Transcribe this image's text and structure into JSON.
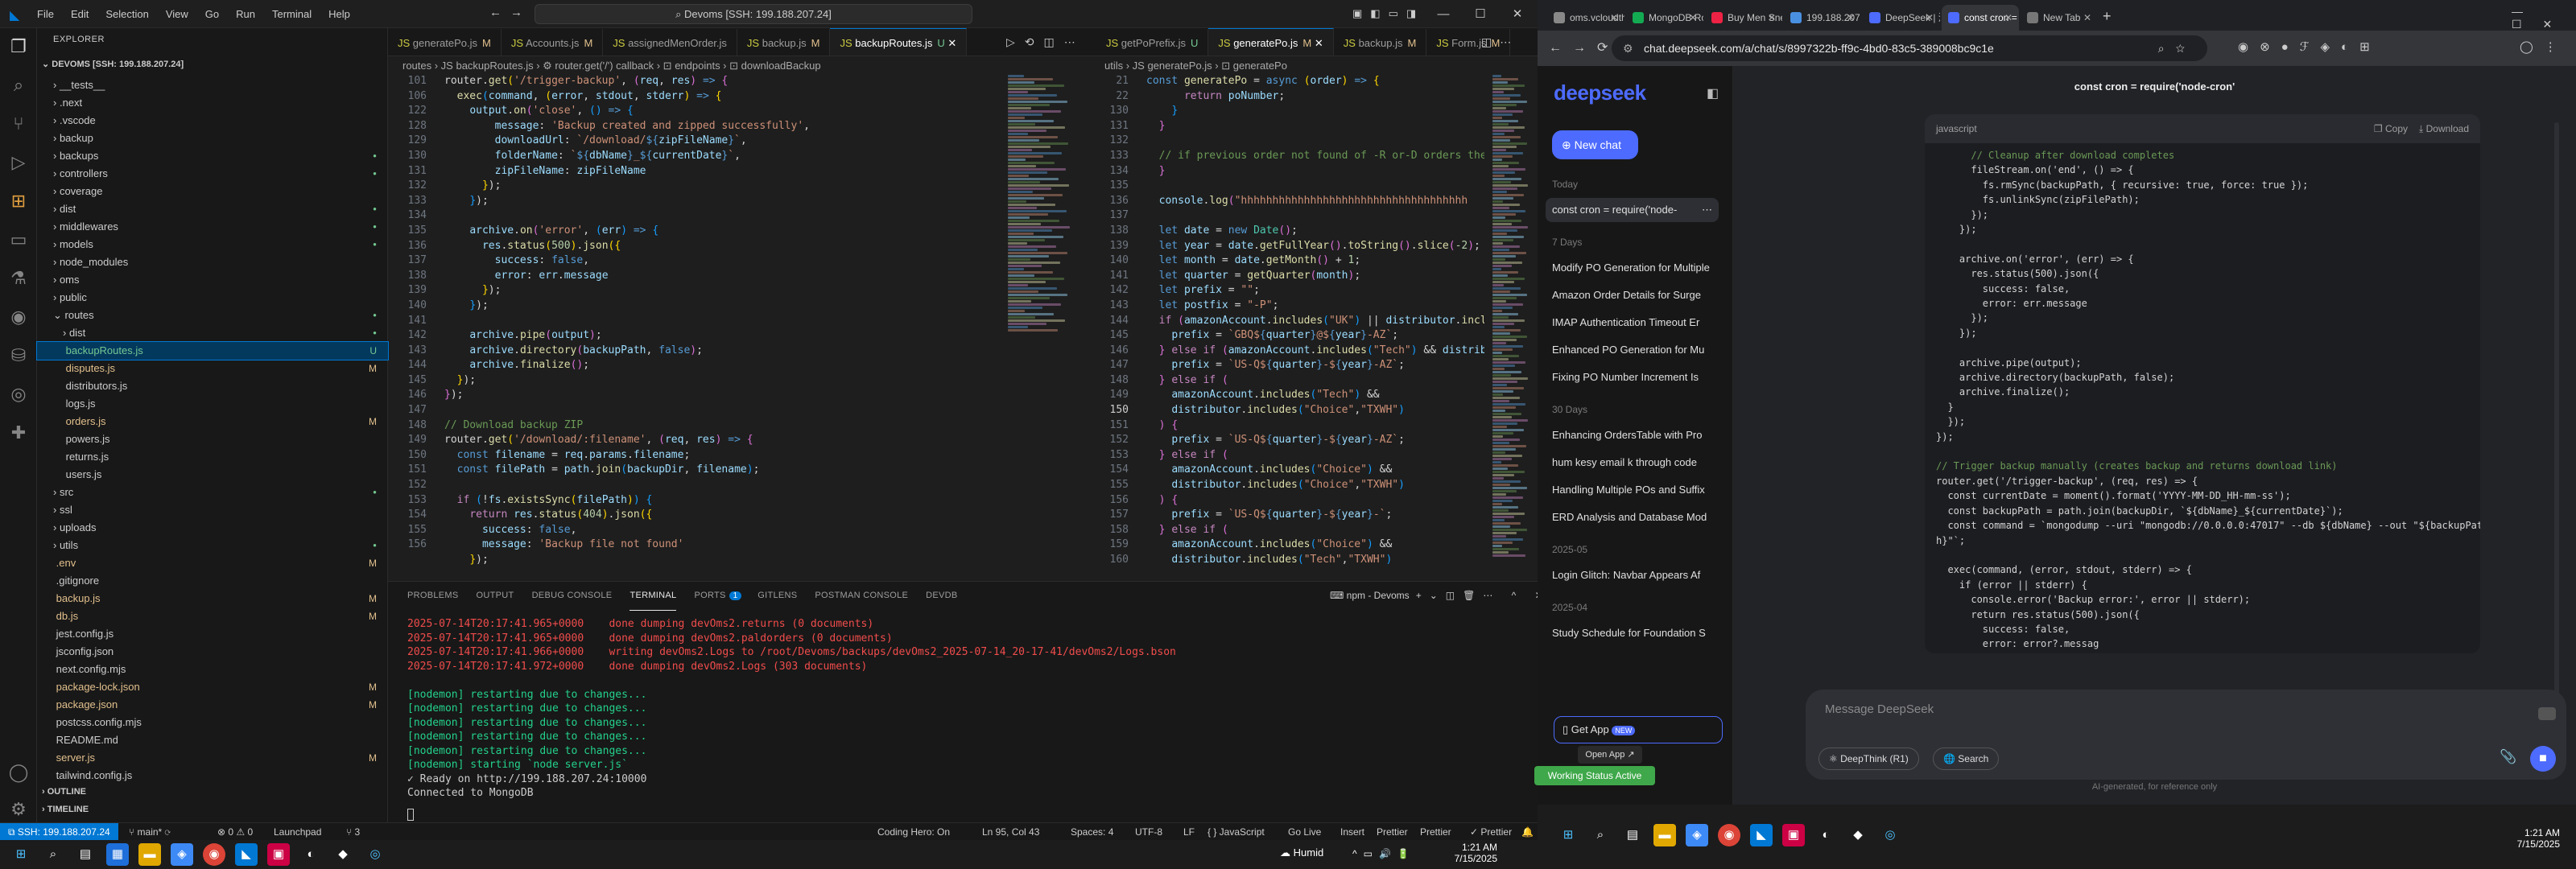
{
  "vscode": {
    "menu": [
      "File",
      "Edit",
      "Selection",
      "View",
      "Go",
      "Run",
      "Terminal",
      "Help"
    ],
    "command_center": "Devoms [SSH: 199.188.207.24]",
    "explorer": {
      "title": "EXPLORER",
      "root": "DEVOMS [SSH: 199.188.207.24]",
      "items": [
        {
          "label": "__tests__",
          "depth": 1,
          "type": "folder",
          "git": ""
        },
        {
          "label": ".next",
          "depth": 1,
          "type": "folder",
          "git": ""
        },
        {
          "label": ".vscode",
          "depth": 1,
          "type": "folder",
          "git": ""
        },
        {
          "label": "backup",
          "depth": 1,
          "type": "folder",
          "git": ""
        },
        {
          "label": "backups",
          "depth": 1,
          "type": "folder",
          "git": "dot"
        },
        {
          "label": "controllers",
          "depth": 1,
          "type": "folder",
          "git": "dot"
        },
        {
          "label": "coverage",
          "depth": 1,
          "type": "folder",
          "git": ""
        },
        {
          "label": "dist",
          "depth": 1,
          "type": "folder",
          "git": "dot"
        },
        {
          "label": "middlewares",
          "depth": 1,
          "type": "folder",
          "git": "dot"
        },
        {
          "label": "models",
          "depth": 1,
          "type": "folder",
          "git": "dot"
        },
        {
          "label": "node_modules",
          "depth": 1,
          "type": "folder",
          "git": ""
        },
        {
          "label": "oms",
          "depth": 1,
          "type": "folder",
          "git": ""
        },
        {
          "label": "public",
          "depth": 1,
          "type": "folder",
          "git": ""
        },
        {
          "label": "routes",
          "depth": 1,
          "type": "folder-open",
          "git": "dot"
        },
        {
          "label": "dist",
          "depth": 2,
          "type": "folder",
          "git": "dot"
        },
        {
          "label": "backupRoutes.js",
          "depth": 2,
          "type": "file",
          "git": "U",
          "selected": true
        },
        {
          "label": "disputes.js",
          "depth": 2,
          "type": "file",
          "git": "M"
        },
        {
          "label": "distributors.js",
          "depth": 2,
          "type": "file",
          "git": ""
        },
        {
          "label": "logs.js",
          "depth": 2,
          "type": "file",
          "git": ""
        },
        {
          "label": "orders.js",
          "depth": 2,
          "type": "file",
          "git": "M"
        },
        {
          "label": "powers.js",
          "depth": 2,
          "type": "file",
          "git": ""
        },
        {
          "label": "returns.js",
          "depth": 2,
          "type": "file",
          "git": ""
        },
        {
          "label": "users.js",
          "depth": 2,
          "type": "file",
          "git": ""
        },
        {
          "label": "src",
          "depth": 1,
          "type": "folder",
          "git": "dot"
        },
        {
          "label": "ssl",
          "depth": 1,
          "type": "folder",
          "git": ""
        },
        {
          "label": "uploads",
          "depth": 1,
          "type": "folder",
          "git": ""
        },
        {
          "label": "utils",
          "depth": 1,
          "type": "folder",
          "git": "dot"
        },
        {
          "label": ".env",
          "depth": 1,
          "type": "file",
          "git": "M"
        },
        {
          "label": ".gitignore",
          "depth": 1,
          "type": "file",
          "git": ""
        },
        {
          "label": "backup.js",
          "depth": 1,
          "type": "file",
          "git": "M"
        },
        {
          "label": "db.js",
          "depth": 1,
          "type": "file",
          "git": "M"
        },
        {
          "label": "jest.config.js",
          "depth": 1,
          "type": "file",
          "git": ""
        },
        {
          "label": "jsconfig.json",
          "depth": 1,
          "type": "file",
          "git": ""
        },
        {
          "label": "next.config.mjs",
          "depth": 1,
          "type": "file",
          "git": ""
        },
        {
          "label": "package-lock.json",
          "depth": 1,
          "type": "file",
          "git": "M"
        },
        {
          "label": "package.json",
          "depth": 1,
          "type": "file",
          "git": "M"
        },
        {
          "label": "postcss.config.mjs",
          "depth": 1,
          "type": "file",
          "git": ""
        },
        {
          "label": "README.md",
          "depth": 1,
          "type": "file",
          "git": ""
        },
        {
          "label": "server.js",
          "depth": 1,
          "type": "file",
          "git": "M"
        },
        {
          "label": "tailwind.config.js",
          "depth": 1,
          "type": "file",
          "git": ""
        }
      ],
      "outline": "OUTLINE",
      "timeline": "TIMELINE"
    },
    "tabs_left": [
      {
        "label": "generatePo.js",
        "mark": "M"
      },
      {
        "label": "Accounts.js",
        "mark": "M"
      },
      {
        "label": "assignedMenOrder.js",
        "mark": ""
      },
      {
        "label": "backup.js",
        "mark": "M"
      },
      {
        "label": "backupRoutes.js",
        "mark": "U",
        "active": true
      }
    ],
    "tabs_right": [
      {
        "label": "getPoPrefix.js",
        "mark": "U"
      },
      {
        "label": "generatePo.js",
        "mark": "M",
        "active": true
      },
      {
        "label": "backup.js",
        "mark": "M"
      },
      {
        "label": "Form.js",
        "mark": "M"
      }
    ],
    "breadcrumb_left": "routes › JS backupRoutes.js › ⚙ router.get('/') callback › ⊡ endpoints › ⊡ downloadBackup",
    "breadcrumb_right": "utils › JS generatePo.js › ⊡ generatePo",
    "left_line_numbers": [
      "101",
      "106",
      "122",
      "128",
      "129",
      "130",
      "131",
      "132",
      "133",
      "134",
      "135",
      "136",
      "137",
      "138",
      "139",
      "140",
      "141",
      "142",
      "143",
      "144",
      "145",
      "146",
      "147",
      "148",
      "149",
      "150",
      "151",
      "152",
      "153",
      "154",
      "155",
      "156"
    ],
    "right_line_numbers": [
      "21",
      "22",
      "130",
      "131",
      "132",
      "133",
      "134",
      "135",
      "136",
      "137",
      "138",
      "139",
      "140",
      "141",
      "142",
      "143",
      "144",
      "145",
      "146",
      "147",
      "148",
      "149",
      "150",
      "151",
      "152",
      "153",
      "154",
      "155",
      "156",
      "157",
      "158",
      "159",
      "160"
    ],
    "panel": {
      "tabs": [
        "PROBLEMS",
        "OUTPUT",
        "DEBUG CONSOLE",
        "TERMINAL",
        "PORTS",
        "GITLENS",
        "POSTMAN CONSOLE",
        "DEVDB"
      ],
      "ports_count": "1",
      "terminal_name": "npm - Devoms",
      "lines": [
        {
          "t": "2025-07-14T20:17:41.965+0000    done dumping devOms2.returns (0 documents)",
          "c": "red"
        },
        {
          "t": "2025-07-14T20:17:41.965+0000    done dumping devOms2.paldorders (0 documents)",
          "c": "red"
        },
        {
          "t": "2025-07-14T20:17:41.966+0000    writing devOms2.Logs to /root/Devoms/backups/devOms2_2025-07-14_20-17-41/devOms2/Logs.bson",
          "c": "red"
        },
        {
          "t": "2025-07-14T20:17:41.972+0000    done dumping devOms2.Logs (303 documents)",
          "c": "red"
        },
        {
          "t": "",
          "c": ""
        },
        {
          "t": "[nodemon] restarting due to changes...",
          "c": "green"
        },
        {
          "t": "[nodemon] restarting due to changes...",
          "c": "green"
        },
        {
          "t": "[nodemon] restarting due to changes...",
          "c": "green"
        },
        {
          "t": "[nodemon] restarting due to changes...",
          "c": "green"
        },
        {
          "t": "[nodemon] restarting due to changes...",
          "c": "green"
        },
        {
          "t": "[nodemon] starting `node server.js`",
          "c": "green"
        },
        {
          "t": "✓ Ready on http://199.188.207.24:10000",
          "c": ""
        },
        {
          "t": "Connected to MongoDB",
          "c": ""
        }
      ]
    },
    "status": {
      "remote": "SSH: 199.188.207.24",
      "branch": "main*",
      "sync": "⟳",
      "errors": "⊗ 0 ⚠ 0",
      "lint": "Launchpad",
      "ports": "⑂ 3",
      "cursor": "Ln 95, Col 43",
      "spaces": "Spaces: 4",
      "encoding": "UTF-8",
      "eol": "LF",
      "language": "{ } JavaScript",
      "golive": "Go Live",
      "insert": "Insert",
      "prettier1": "Prettier",
      "prettier2": "Prettier",
      "prettier3": "✓ Prettier",
      "coding_hero": "Coding Hero: On"
    },
    "taskbar": {
      "weather": "Humid",
      "time": "1:21 AM",
      "date": "7/15/2025"
    }
  },
  "chrome": {
    "tabs": [
      {
        "label": "oms.vcloudth",
        "color": "#888"
      },
      {
        "label": "MongoDB Ro",
        "color": "#13aa52"
      },
      {
        "label": "Buy Men Sne",
        "color": "#e24"
      },
      {
        "label": "199.188.207",
        "color": "#4a90e2"
      },
      {
        "label": "DeepSeek | 深",
        "color": "#4d6bfe"
      },
      {
        "label": "const cron =",
        "color": "#4d6bfe",
        "active": true
      },
      {
        "label": "New Tab",
        "color": "#777"
      }
    ],
    "url": "chat.deepseek.com/a/chat/s/8997322b-ff9c-4bd0-83c5-389008bc9c1e"
  },
  "deepseek": {
    "logo": "deepseek",
    "new_chat": "New chat",
    "sections": [
      {
        "heading": "Today",
        "items": [
          "const cron = require('node-"
        ]
      },
      {
        "heading": "7 Days",
        "items": [
          "Modify PO Generation for Multiple",
          "Amazon Order Details for Surge",
          "IMAP Authentication Timeout Er",
          "Enhanced PO Generation for Mu",
          "Fixing PO Number Increment Is"
        ]
      },
      {
        "heading": "30 Days",
        "items": [
          "Enhancing OrdersTable with Pro",
          "hum kesy email k through code",
          "Handling Multiple POs and Suffix",
          "ERD Analysis and Database Mod"
        ]
      },
      {
        "heading": "2025-05",
        "items": [
          "Login Glitch: Navbar Appears Af"
        ]
      },
      {
        "heading": "2025-04",
        "items": [
          "Study Schedule for Foundation S"
        ]
      }
    ],
    "get_app": "Get App",
    "new_badge": "NEW",
    "open_app": "Open App ↗",
    "chat_title": "const cron = require('node-cron'",
    "code_lang": "javascript",
    "copy": "Copy",
    "download": "Download",
    "code_lines": [
      "      // Cleanup after download completes",
      "      fileStream.on('end', () => {",
      "        fs.rmSync(backupPath, { recursive: true, force: true });",
      "        fs.unlinkSync(zipFilePath);",
      "      });",
      "    });",
      "",
      "    archive.on('error', (err) => {",
      "      res.status(500).json({",
      "        success: false,",
      "        error: err.message",
      "      });",
      "    });",
      "",
      "    archive.pipe(output);",
      "    archive.directory(backupPath, false);",
      "    archive.finalize();",
      "  }",
      "  });",
      "});",
      "",
      "// Trigger backup manually (creates backup and returns download link)",
      "router.get('/trigger-backup', (req, res) => {",
      "  const currentDate = moment().format('YYYY-MM-DD_HH-mm-ss');",
      "  const backupPath = path.join(backupDir, `${dbName}_${currentDate}`);",
      "  const command = `mongodump --uri \"mongodb://0.0.0.0:47017\" --db ${dbName} --out \"${backupPat",
      "h}\"`;",
      "",
      "  exec(command, (error, stdout, stderr) => {",
      "    if (error || stderr) {",
      "      console.error('Backup error:', error || stderr);",
      "      return res.status(500).json({",
      "        success: false,",
      "        error: error?.messag"
    ],
    "placeholder": "Message DeepSeek",
    "deepthink": "DeepThink (R1)",
    "search": "Search",
    "disclaimer": "AI-generated, for reference only"
  },
  "overlay": {
    "status_pill": "Working Status Active"
  },
  "taskbar2": {
    "time": "1:21 AM",
    "date": "7/15/2025"
  }
}
